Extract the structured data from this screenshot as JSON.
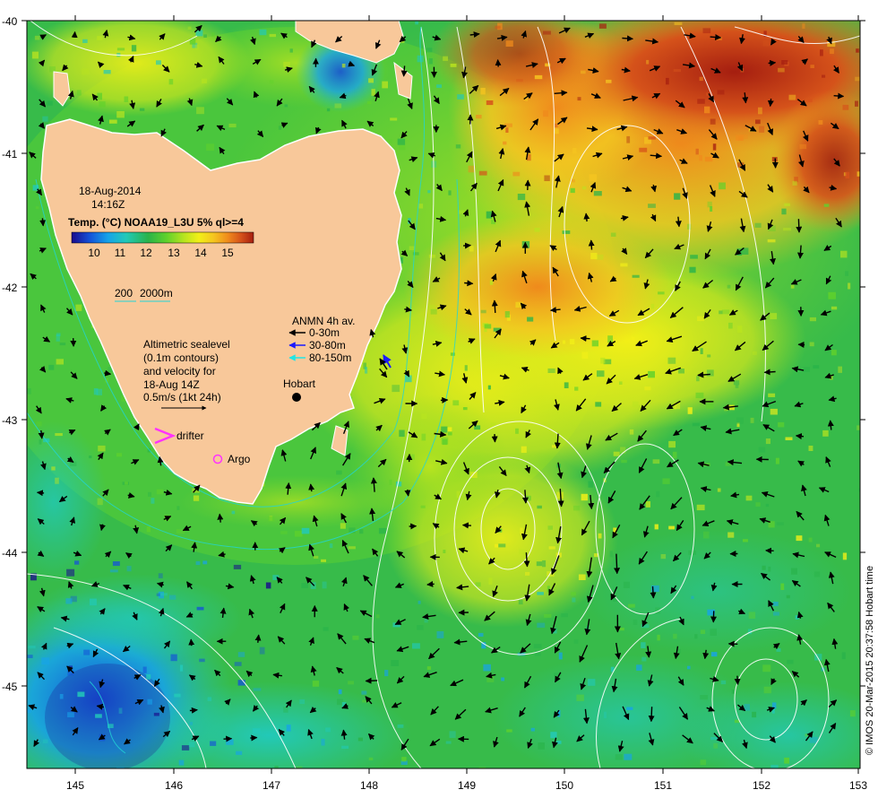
{
  "map": {
    "date": "18-Aug-2014",
    "time": "14:16Z",
    "product": "Temp. (°C) NOAA19_L3U 5% ql>=4",
    "colorbar": {
      "ticks": [
        "10",
        "11",
        "12",
        "13",
        "14",
        "15"
      ],
      "colors": [
        "#1a0a8c",
        "#1452d8",
        "#17a3e8",
        "#22c9b8",
        "#29b34a",
        "#5fd12c",
        "#b9e41f",
        "#f2ef17",
        "#f5c520",
        "#ef8a1c",
        "#d5521a",
        "#a51e10"
      ]
    },
    "depth_legend": {
      "d200": "200",
      "d2000": "2000m"
    },
    "altimetry_note": [
      "Altimetric sealevel",
      "(0.1m contours)",
      "and velocity for",
      "18-Aug 14Z",
      "0.5m/s (1kt 24h)"
    ],
    "anmn": {
      "title": "ANMN 4h av.",
      "items": [
        {
          "label": "0-30m",
          "color": "#000000"
        },
        {
          "label": "30-80m",
          "color": "#1a1aff"
        },
        {
          "label": "80-150m",
          "color": "#22e5e5"
        }
      ]
    },
    "markers": {
      "hobart": "Hobart",
      "drifter": "drifter",
      "argo": "Argo"
    },
    "credit": "© IMOS 20-Mar-2015 20:37:58 Hobart time",
    "x_ticks": [
      "145",
      "146",
      "147",
      "148",
      "149",
      "150",
      "151",
      "152",
      "153"
    ],
    "y_ticks": [
      "-40",
      "-41",
      "-42",
      "-43",
      "-44",
      "-45"
    ],
    "land_color": "#f8c89a"
  }
}
